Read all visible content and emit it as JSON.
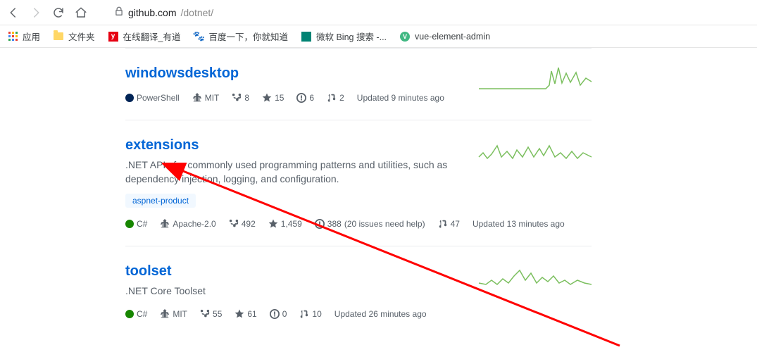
{
  "browser": {
    "url_host": "github.com",
    "url_path": "/dotnet/"
  },
  "bookmarks": {
    "apps": "应用",
    "folder": "文件夹",
    "youdao": "在线翻译_有道",
    "baidu": "百度一下，你就知道",
    "bing": "微软 Bing 搜索 -...",
    "vue": "vue-element-admin"
  },
  "colors": {
    "powershell": "#012456",
    "csharp": "#178600"
  },
  "repos": [
    {
      "name": "windowsdesktop",
      "desc": "",
      "topics": [],
      "lang": "PowerShell",
      "license": "MIT",
      "forks": "8",
      "stars": "15",
      "issues": "6",
      "issues_extra": "",
      "prs": "2",
      "updated": "Updated 9 minutes ago"
    },
    {
      "name": "extensions",
      "desc": ".NET APIs for commonly used programming patterns and utilities, such as dependency injection, logging, and configuration.",
      "topics": [
        "aspnet-product"
      ],
      "lang": "C#",
      "license": "Apache-2.0",
      "forks": "492",
      "stars": "1,459",
      "issues": "388",
      "issues_extra": "(20 issues need help)",
      "prs": "47",
      "updated": "Updated 13 minutes ago"
    },
    {
      "name": "toolset",
      "desc": ".NET Core Toolset",
      "topics": [],
      "lang": "C#",
      "license": "MIT",
      "forks": "55",
      "stars": "61",
      "issues": "0",
      "issues_extra": "",
      "prs": "10",
      "updated": "Updated 26 minutes ago"
    }
  ]
}
